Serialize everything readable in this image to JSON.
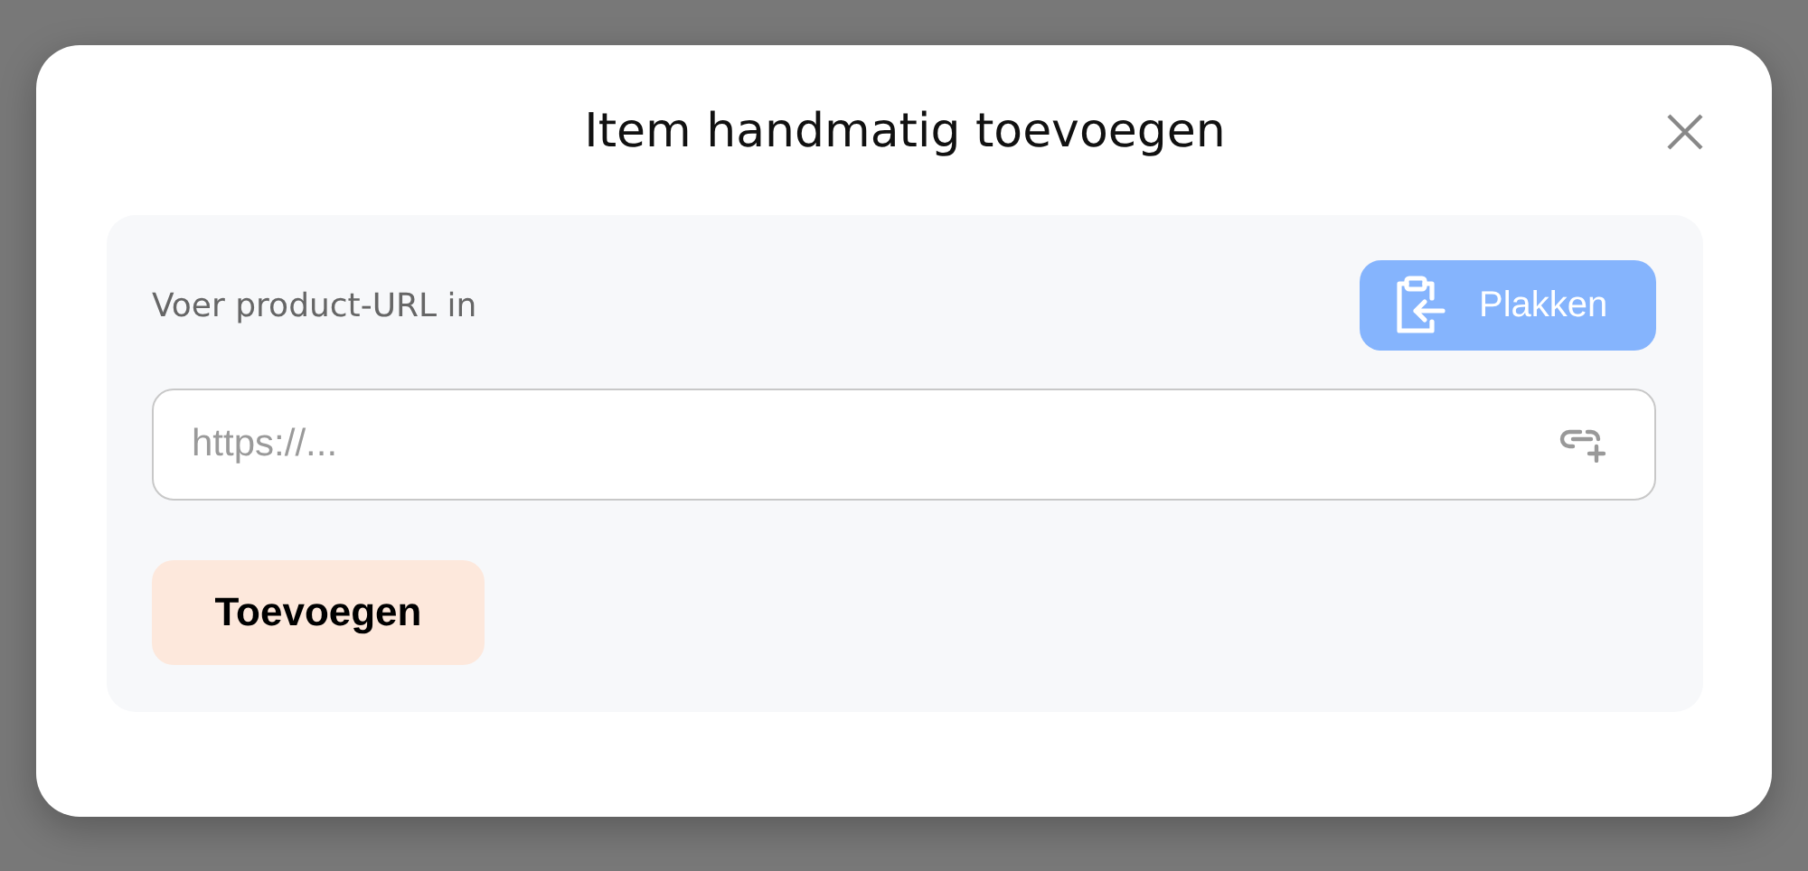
{
  "dialog": {
    "title": "Item handmatig toevoegen"
  },
  "url_section": {
    "label": "Voer product-URL in",
    "paste_button": "Plakken",
    "url_field": {
      "placeholder": "https://..."
    },
    "add_button": "Toevoegen"
  }
}
